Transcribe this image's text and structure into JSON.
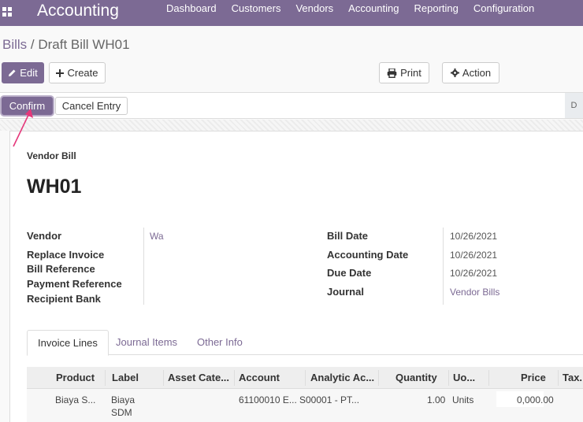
{
  "topbar": {
    "app_title": "Accounting",
    "nav": [
      "Dashboard",
      "Customers",
      "Vendors",
      "Accounting",
      "Reporting",
      "Configuration"
    ]
  },
  "breadcrumb": {
    "parent": "Bills",
    "separator": " / ",
    "current": "Draft Bill WH01"
  },
  "toolbar": {
    "edit": "Edit",
    "create": "Create",
    "print": "Print",
    "action": "Action"
  },
  "statusbar": {
    "confirm": "Confirm",
    "cancel_entry": "Cancel Entry",
    "stage": "D"
  },
  "document": {
    "type": "Vendor Bill",
    "name": "WH01",
    "left_fields": [
      {
        "label": "Vendor",
        "value": "Wa"
      },
      {
        "label": "Replace Invoice",
        "value": ""
      },
      {
        "label": "Bill Reference",
        "value": ""
      },
      {
        "label": "Payment Reference",
        "value": ""
      },
      {
        "label": "Recipient Bank",
        "value": ""
      }
    ],
    "right_fields": [
      {
        "label": "Bill Date",
        "value": "10/26/2021"
      },
      {
        "label": "Accounting Date",
        "value": "10/26/2021"
      },
      {
        "label": "Due Date",
        "value": "10/26/2021"
      },
      {
        "label": "Journal",
        "value": "Vendor Bills"
      }
    ]
  },
  "tabs": [
    "Invoice Lines",
    "Journal Items",
    "Other Info"
  ],
  "lines_table": {
    "columns": [
      "Product",
      "Label",
      "Asset Cate...",
      "Account",
      "Analytic Ac...",
      "Quantity",
      "Uo...",
      "Price",
      "Tax."
    ],
    "rows": [
      {
        "product": "Biaya S...",
        "label_line1": "Biaya",
        "label_line2": "SDM",
        "asset_category": "",
        "account": "61100010 E...",
        "analytic": "S00001 - PT...",
        "quantity": "1.00",
        "uom": "Units",
        "price": "0,000.00"
      }
    ]
  },
  "colors": {
    "brand": "#7c6a94",
    "annotation_arrow": "#e5377a"
  }
}
